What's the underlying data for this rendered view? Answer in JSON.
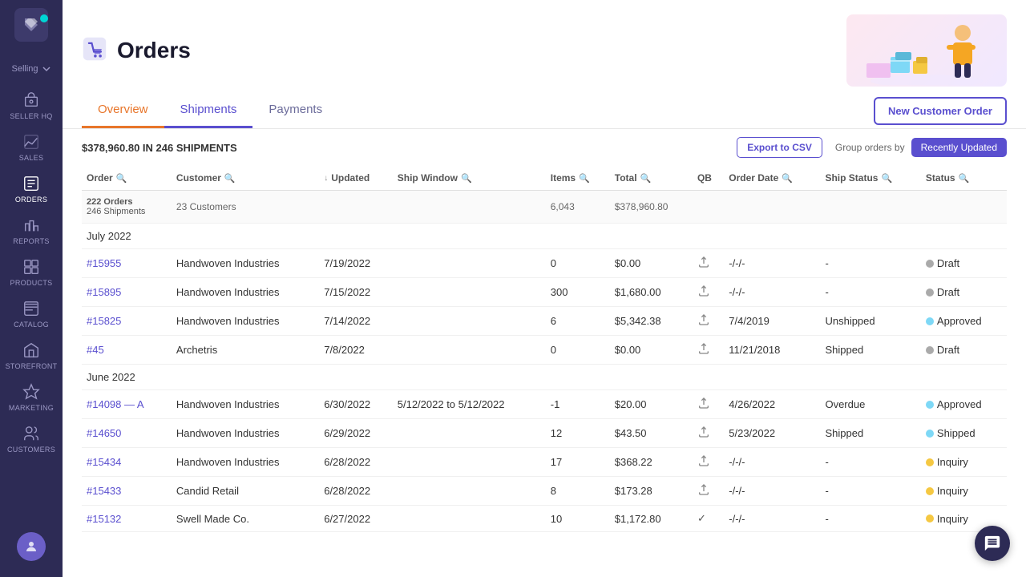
{
  "sidebar": {
    "logo_alt": "app-logo",
    "selling_label": "Selling",
    "items": [
      {
        "id": "seller-hq",
        "label": "SELLER HQ",
        "active": false
      },
      {
        "id": "sales",
        "label": "SALES",
        "active": false
      },
      {
        "id": "orders",
        "label": "ORDERS",
        "active": true
      },
      {
        "id": "reports",
        "label": "REPORTS",
        "active": false
      },
      {
        "id": "products",
        "label": "PRODUCTS",
        "active": false
      },
      {
        "id": "catalog",
        "label": "CATALOG",
        "active": false
      },
      {
        "id": "storefront",
        "label": "STOREFRONT",
        "active": false
      },
      {
        "id": "marketing",
        "label": "MARKETING",
        "active": false
      },
      {
        "id": "customers",
        "label": "CUSTOMERS",
        "active": false
      }
    ]
  },
  "header": {
    "title": "Orders",
    "icon_alt": "orders-icon"
  },
  "tabs": [
    {
      "id": "overview",
      "label": "Overview",
      "state": "active-orange"
    },
    {
      "id": "shipments",
      "label": "Shipments",
      "state": "active-purple"
    },
    {
      "id": "payments",
      "label": "Payments",
      "state": ""
    }
  ],
  "new_order_button": "New Customer Order",
  "toolbar": {
    "summary": "$378,960.80 IN 246 SHIPMENTS",
    "export_label": "Export to CSV",
    "group_label": "Group orders by",
    "group_value": "Recently Updated"
  },
  "table": {
    "columns": [
      {
        "id": "order",
        "label": "Order",
        "sortable": true,
        "searchable": true
      },
      {
        "id": "customer",
        "label": "Customer",
        "searchable": true
      },
      {
        "id": "updated",
        "label": "Updated",
        "sort_active": true
      },
      {
        "id": "ship_window",
        "label": "Ship Window",
        "searchable": true
      },
      {
        "id": "items",
        "label": "Items",
        "searchable": true
      },
      {
        "id": "total",
        "label": "Total",
        "searchable": true
      },
      {
        "id": "qb",
        "label": "QB"
      },
      {
        "id": "order_date",
        "label": "Order Date",
        "searchable": true
      },
      {
        "id": "ship_status",
        "label": "Ship Status",
        "searchable": true
      },
      {
        "id": "status",
        "label": "Status",
        "searchable": true
      }
    ],
    "summary_row": {
      "orders": "222 Orders",
      "shipments": "246 Shipments",
      "customers": "23 Customers",
      "items": "6,043",
      "total": "$378,960.80"
    },
    "sections": [
      {
        "id": "july-2022",
        "label": "July 2022",
        "rows": [
          {
            "order": "#15955",
            "customer": "Handwoven Industries",
            "updated": "7/19/2022",
            "ship_window": "",
            "items": "0",
            "total": "$0.00",
            "qb": "upload",
            "order_date": "-/-/-",
            "ship_status": "-",
            "status": "Draft",
            "status_type": "draft"
          },
          {
            "order": "#15895",
            "customer": "Handwoven Industries",
            "updated": "7/15/2022",
            "ship_window": "",
            "items": "300",
            "total": "$1,680.00",
            "qb": "upload",
            "order_date": "-/-/-",
            "ship_status": "-",
            "status": "Draft",
            "status_type": "draft"
          },
          {
            "order": "#15825",
            "customer": "Handwoven Industries",
            "updated": "7/14/2022",
            "ship_window": "",
            "items": "6",
            "total": "$5,342.38",
            "qb": "upload",
            "order_date": "7/4/2019",
            "ship_status": "Unshipped",
            "status": "Approved",
            "status_type": "approved"
          },
          {
            "order": "#45",
            "customer": "Archetris",
            "updated": "7/8/2022",
            "ship_window": "",
            "items": "0",
            "total": "$0.00",
            "qb": "upload",
            "order_date": "11/21/2018",
            "ship_status": "Shipped",
            "status": "Draft",
            "status_type": "draft"
          }
        ]
      },
      {
        "id": "june-2022",
        "label": "June 2022",
        "rows": [
          {
            "order": "#14098 — A",
            "customer": "Handwoven Industries",
            "updated": "6/30/2022",
            "ship_window": "5/12/2022 to 5/12/2022",
            "items": "-1",
            "total": "$20.00",
            "qb": "upload",
            "order_date": "4/26/2022",
            "ship_status": "Overdue",
            "status": "Approved",
            "status_type": "approved"
          },
          {
            "order": "#14650",
            "customer": "Handwoven Industries",
            "updated": "6/29/2022",
            "ship_window": "",
            "items": "12",
            "total": "$43.50",
            "qb": "upload",
            "order_date": "5/23/2022",
            "ship_status": "Shipped",
            "status": "Shipped",
            "status_type": "shipped"
          },
          {
            "order": "#15434",
            "customer": "Handwoven Industries",
            "updated": "6/28/2022",
            "ship_window": "",
            "items": "17",
            "total": "$368.22",
            "qb": "upload",
            "order_date": "-/-/-",
            "ship_status": "-",
            "status": "Inquiry",
            "status_type": "inquiry"
          },
          {
            "order": "#15433",
            "customer": "Candid Retail",
            "updated": "6/28/2022",
            "ship_window": "",
            "items": "8",
            "total": "$173.28",
            "qb": "upload",
            "order_date": "-/-/-",
            "ship_status": "-",
            "status": "Inquiry",
            "status_type": "inquiry"
          },
          {
            "order": "#15132",
            "customer": "Swell Made Co.",
            "updated": "6/27/2022",
            "ship_window": "",
            "items": "10",
            "total": "$1,172.80",
            "qb": "check",
            "order_date": "-/-/-",
            "ship_status": "-",
            "status": "Inquiry",
            "status_type": "inquiry"
          }
        ]
      }
    ]
  }
}
